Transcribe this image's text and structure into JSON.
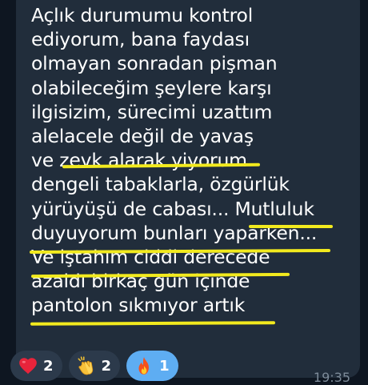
{
  "message": {
    "lines": [
      "Açlık durumumu kontrol",
      "ediyorum, bana faydası",
      "olmayan sonradan pişman",
      "olabileceğim şeylere karşı",
      "ilgisizim, sürecimi uzattım",
      "alelacele değil de yavaş",
      "ve zevk alarak yiyorum",
      "dengeli tabaklarla, özgürlük",
      "yürüyüşü de cabası... Mutluluk",
      "duyuyorum bunları yaparken...",
      "Ve iştahım ciddi derecede",
      "azaldı birkaç gün içinde",
      "pantolon sıkmıyor artık"
    ],
    "time": "19:35"
  },
  "reactions": [
    {
      "icon": "heart-icon",
      "count": "2",
      "chosen": false
    },
    {
      "icon": "clapping-hands-icon",
      "count": "2",
      "chosen": false
    },
    {
      "icon": "fire-icon",
      "count": "1",
      "chosen": true
    }
  ],
  "colors": {
    "chat_background": "#0e1621",
    "bubble": "#212d3b",
    "text": "#ffffff",
    "highlight_underline": "#f2ea1e",
    "reaction_chip": "#2c3a4b",
    "reaction_chosen": "#5eadf2",
    "timestamp": "#7d8b99"
  }
}
